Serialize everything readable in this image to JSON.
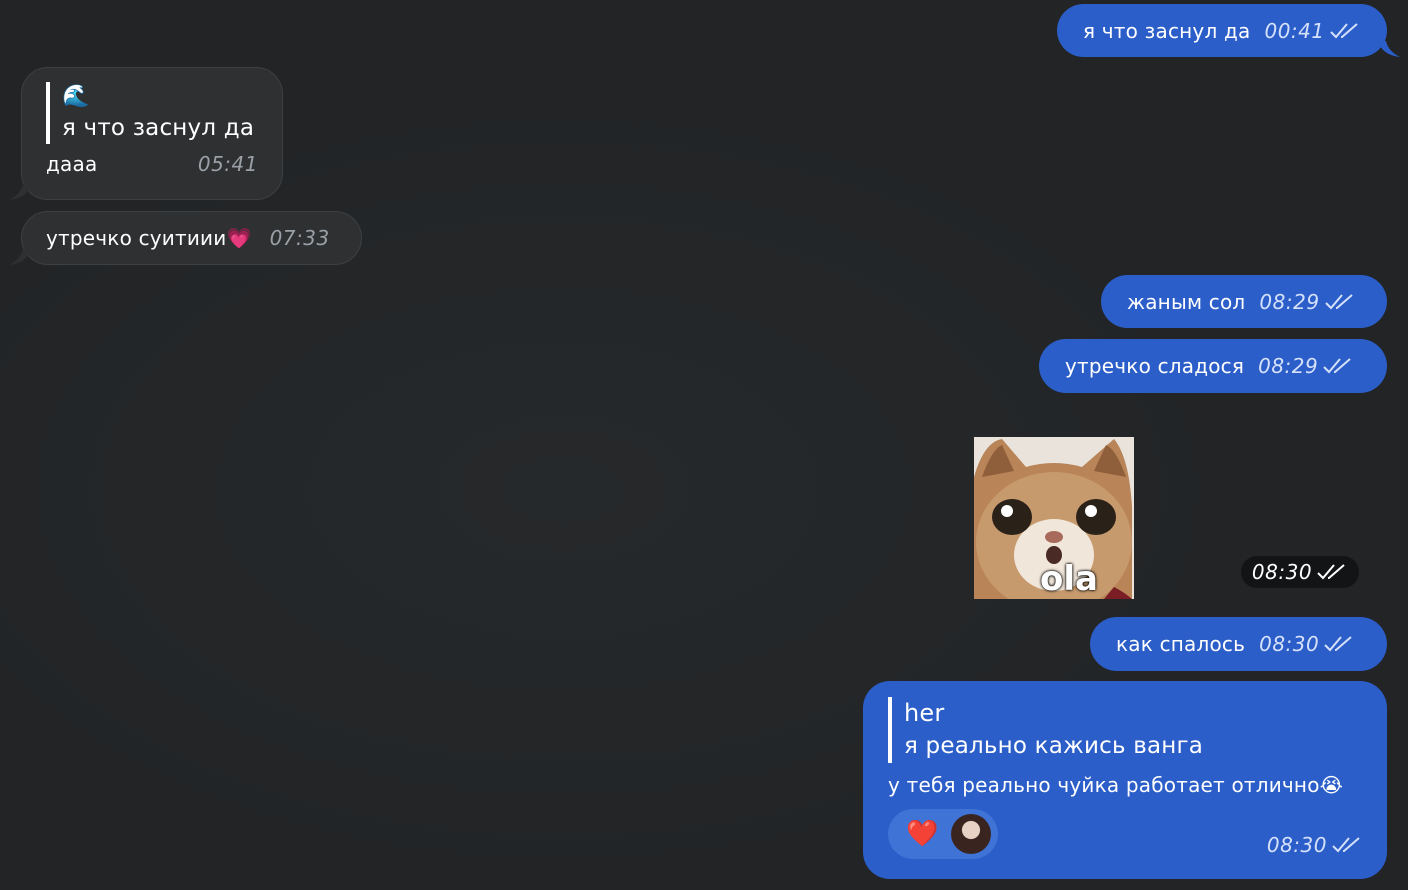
{
  "messages": [
    {
      "id": "m1",
      "direction": "outgoing",
      "text": "я что заснул да",
      "time": "00:41",
      "status": "read"
    },
    {
      "id": "m2",
      "direction": "incoming",
      "reply_emoji": "🌊",
      "reply_text": "я что заснул да",
      "text": "дааа",
      "time": "05:41"
    },
    {
      "id": "m3",
      "direction": "incoming",
      "text": "утречко суитиии",
      "emoji": "💗",
      "time": "07:33"
    },
    {
      "id": "m4",
      "direction": "outgoing",
      "text": "жаным сол",
      "time": "08:29",
      "status": "read"
    },
    {
      "id": "m5",
      "direction": "outgoing",
      "text": "утречко сладося",
      "time": "08:29",
      "status": "read"
    },
    {
      "id": "m6",
      "direction": "outgoing",
      "type": "sticker",
      "sticker_caption": "ola",
      "time": "08:30",
      "status": "read"
    },
    {
      "id": "m7",
      "direction": "outgoing",
      "text": "как спалось",
      "time": "08:30",
      "status": "read"
    },
    {
      "id": "m8",
      "direction": "outgoing",
      "reply_author": "her",
      "reply_text": "я реально кажись ванга",
      "text": "у тебя реально чуйка работает отлично",
      "emoji": "😭",
      "reaction": "❤️",
      "time": "08:30",
      "status": "read"
    }
  ],
  "colors": {
    "background": "#222426",
    "outgoing_bubble": "#2b5ec8",
    "incoming_bubble": "#2e3032"
  },
  "icons": {
    "read_status": "double-check-icon",
    "reaction_avatar": "avatar"
  }
}
